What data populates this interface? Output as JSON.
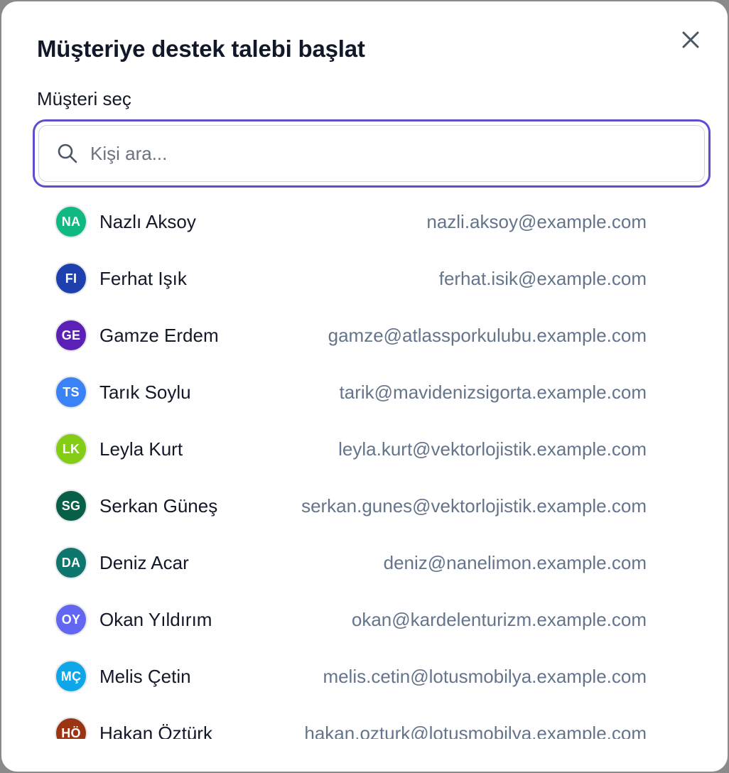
{
  "dialog": {
    "title": "Müşteriye destek talebi başlat",
    "field_label": "Müşteri seç",
    "search": {
      "value": "",
      "placeholder": "Kişi ara..."
    }
  },
  "icons": {
    "search": "search-icon",
    "close": "close-icon"
  },
  "colors": {
    "focus_ring": "#5b4fcf",
    "email_text": "#64748b",
    "name_text": "#111827"
  },
  "contacts": [
    {
      "initials": "NA",
      "name": "Nazlı Aksoy",
      "email": "nazli.aksoy@example.com",
      "color": "#10b981"
    },
    {
      "initials": "FI",
      "name": "Ferhat Işık",
      "email": "ferhat.isik@example.com",
      "color": "#1e40af"
    },
    {
      "initials": "GE",
      "name": "Gamze Erdem",
      "email": "gamze@atlassporkulubu.example.com",
      "color": "#5b21b6"
    },
    {
      "initials": "TS",
      "name": "Tarık Soylu",
      "email": "tarik@mavidenizsigorta.example.com",
      "color": "#3b82f6"
    },
    {
      "initials": "LK",
      "name": "Leyla Kurt",
      "email": "leyla.kurt@vektorlojistik.example.com",
      "color": "#84cc16"
    },
    {
      "initials": "SG",
      "name": "Serkan Güneş",
      "email": "serkan.gunes@vektorlojistik.example.com",
      "color": "#065f46"
    },
    {
      "initials": "DA",
      "name": "Deniz Acar",
      "email": "deniz@nanelimon.example.com",
      "color": "#0f766e"
    },
    {
      "initials": "OY",
      "name": "Okan Yıldırım",
      "email": "okan@kardelenturizm.example.com",
      "color": "#6366f1"
    },
    {
      "initials": "MÇ",
      "name": "Melis Çetin",
      "email": "melis.cetin@lotusmobilya.example.com",
      "color": "#0ea5e9"
    },
    {
      "initials": "HÖ",
      "name": "Hakan Öztürk",
      "email": "hakan.ozturk@lotusmobilya.example.com",
      "color": "#9a3412"
    }
  ]
}
